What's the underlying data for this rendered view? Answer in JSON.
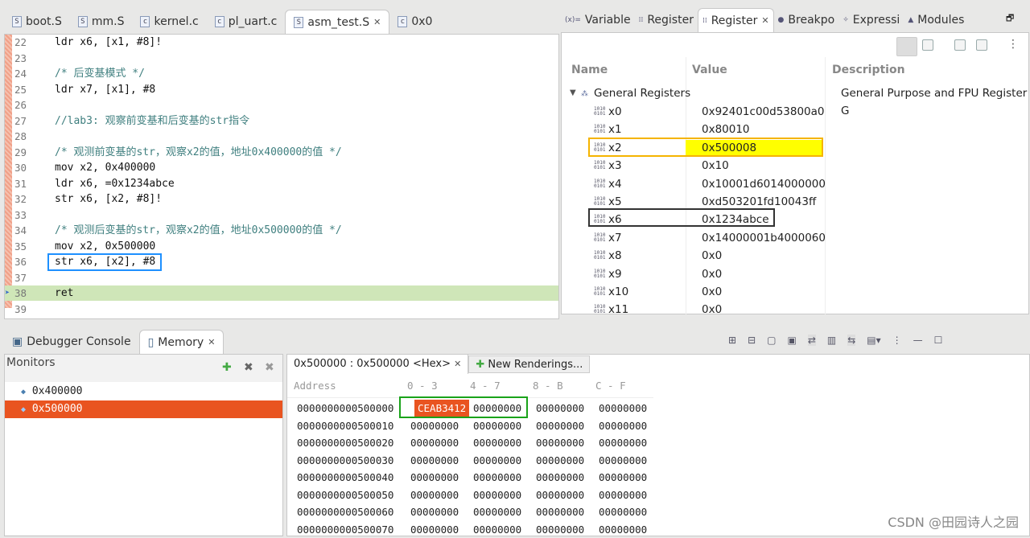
{
  "editor": {
    "tabs": [
      {
        "label": "boot.S",
        "icon": "S"
      },
      {
        "label": "mm.S",
        "icon": "S"
      },
      {
        "label": "kernel.c",
        "icon": "c"
      },
      {
        "label": "pl_uart.c",
        "icon": "c"
      },
      {
        "label": "asm_test.S",
        "icon": "S",
        "active": true
      },
      {
        "label": "0x0",
        "icon": "c"
      }
    ],
    "lines": [
      {
        "n": "22",
        "t": "ldr x6, [x1, #8]!"
      },
      {
        "n": "23",
        "t": ""
      },
      {
        "n": "24",
        "t": "/* 后变基模式 */",
        "c": true
      },
      {
        "n": "25",
        "t": "ldr x7, [x1], #8"
      },
      {
        "n": "26",
        "t": ""
      },
      {
        "n": "27",
        "t": "//lab3: 观察前变基和后变基的str指令",
        "c": true
      },
      {
        "n": "28",
        "t": ""
      },
      {
        "n": "29",
        "t": "/* 观测前变基的str，观察x2的值，地址0x400000的值 */",
        "c": true
      },
      {
        "n": "30",
        "t": "mov x2, 0x400000"
      },
      {
        "n": "31",
        "t": "ldr x6, =0x1234abce"
      },
      {
        "n": "32",
        "t": "str x6, [x2, #8]!"
      },
      {
        "n": "33",
        "t": ""
      },
      {
        "n": "34",
        "t": "/* 观测后变基的str，观察x2的值，地址0x500000的值 */",
        "c": true
      },
      {
        "n": "35",
        "t": "mov x2, 0x500000"
      },
      {
        "n": "36",
        "t": "str x6, [x2], #8"
      },
      {
        "n": "37",
        "t": ""
      },
      {
        "n": "38",
        "t": "ret",
        "current": true
      },
      {
        "n": "39",
        "t": ""
      }
    ]
  },
  "registers": {
    "tabs": [
      "Variable",
      "Register",
      "Register",
      "Breakpo",
      "Expressi",
      "Modules"
    ],
    "columns": [
      "Name",
      "Value",
      "Description"
    ],
    "group": {
      "name": "General Registers",
      "description": "General Purpose and FPU Register G"
    },
    "rows": [
      {
        "name": "x0",
        "value": "0x92401c00d53800a0"
      },
      {
        "name": "x1",
        "value": "0x80010"
      },
      {
        "name": "x2",
        "value": "0x500008",
        "changed": true
      },
      {
        "name": "x3",
        "value": "0x10"
      },
      {
        "name": "x4",
        "value": "0x10001d6014000000"
      },
      {
        "name": "x5",
        "value": "0xd503201fd10043ff"
      },
      {
        "name": "x6",
        "value": "0x1234abce"
      },
      {
        "name": "x7",
        "value": "0x14000001b4000060"
      },
      {
        "name": "x8",
        "value": "0x0"
      },
      {
        "name": "x9",
        "value": "0x0"
      },
      {
        "name": "x10",
        "value": "0x0"
      },
      {
        "name": "x11",
        "value": "0x0"
      }
    ]
  },
  "bottom": {
    "tabs": [
      "Debugger Console",
      "Memory"
    ],
    "monitors_label": "Monitors",
    "monitors": [
      "0x400000",
      "0x500000"
    ],
    "rendering_tab": "0x500000 : 0x500000 <Hex>",
    "new_renderings": "New Renderings...",
    "columns": [
      "Address",
      "0 - 3",
      "4 - 7",
      "8 - B",
      "C - F"
    ],
    "rows": [
      [
        "0000000000500000",
        "CEAB3412",
        "00000000",
        "00000000",
        "00000000"
      ],
      [
        "0000000000500010",
        "00000000",
        "00000000",
        "00000000",
        "00000000"
      ],
      [
        "0000000000500020",
        "00000000",
        "00000000",
        "00000000",
        "00000000"
      ],
      [
        "0000000000500030",
        "00000000",
        "00000000",
        "00000000",
        "00000000"
      ],
      [
        "0000000000500040",
        "00000000",
        "00000000",
        "00000000",
        "00000000"
      ],
      [
        "0000000000500050",
        "00000000",
        "00000000",
        "00000000",
        "00000000"
      ],
      [
        "0000000000500060",
        "00000000",
        "00000000",
        "00000000",
        "00000000"
      ],
      [
        "0000000000500070",
        "00000000",
        "00000000",
        "00000000",
        "00000000"
      ]
    ]
  },
  "watermark": "CSDN @田园诗人之园",
  "colors": {
    "selection": "#e95420",
    "changed": "#ffff00",
    "current_line": "#cfe6b8"
  }
}
